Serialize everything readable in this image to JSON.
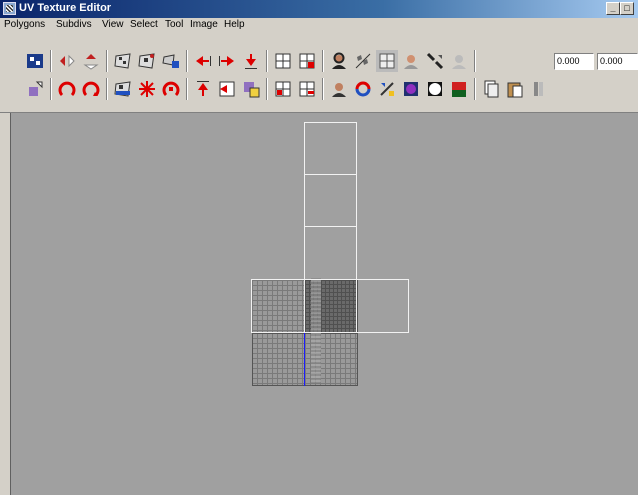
{
  "window": {
    "title": "UV Texture Editor",
    "min_label": "_",
    "max_label": "□"
  },
  "menu": {
    "items": [
      "Polygons",
      "Subdivs",
      "View",
      "Select",
      "Tool",
      "Image",
      "Help"
    ]
  },
  "toolbar": {
    "field1_value": "0.000",
    "field2_value": "0.000"
  },
  "colors": {
    "viewport_bg": "#a0a0a0",
    "uv_border": "#f2f2f2",
    "v_axis": "#1a1aff"
  }
}
